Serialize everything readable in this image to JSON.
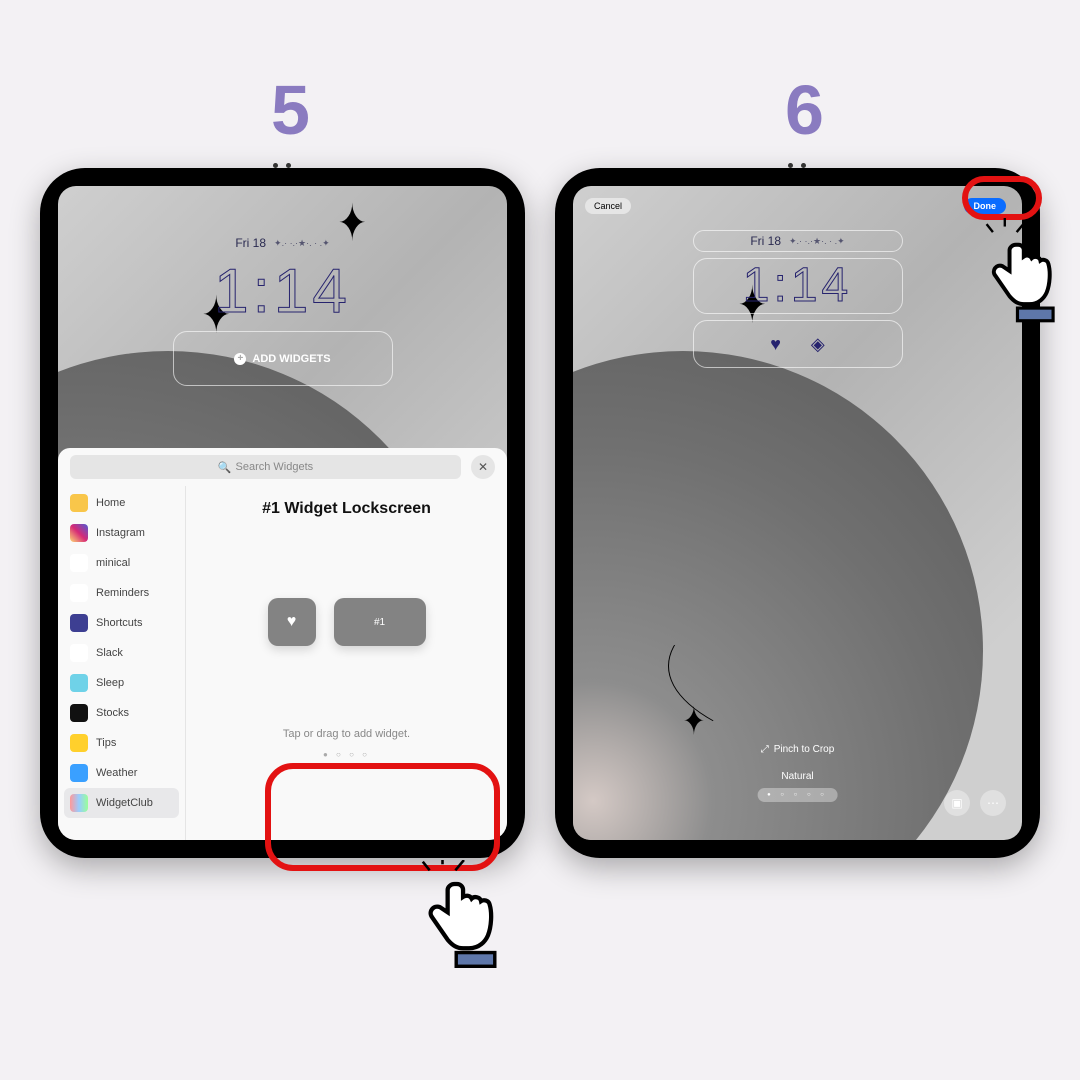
{
  "step_left_number": "5",
  "step_right_number": "6",
  "lock": {
    "date": "Fri 18",
    "date_deco": "✦.· ·.·★·. · .✦",
    "time": "1:14",
    "add_widgets_label": "ADD WIDGETS"
  },
  "sheet": {
    "search_placeholder": "Search Widgets",
    "apps": [
      {
        "name": "Home",
        "color": "#f9c64a"
      },
      {
        "name": "Instagram",
        "color": "linear-gradient(45deg,#feda75,#d62976,#4f5bd5)"
      },
      {
        "name": "minical",
        "color": "#fff"
      },
      {
        "name": "Reminders",
        "color": "#fff"
      },
      {
        "name": "Shortcuts",
        "color": "#3d3f92"
      },
      {
        "name": "Slack",
        "color": "#fff"
      },
      {
        "name": "Sleep",
        "color": "#6fd2e8"
      },
      {
        "name": "Stocks",
        "color": "#111"
      },
      {
        "name": "Tips",
        "color": "#ffd02c"
      },
      {
        "name": "Weather",
        "color": "#3aa0ff"
      },
      {
        "name": "WidgetClub",
        "color": "linear-gradient(90deg,#f99,#9cf,#9f9)"
      }
    ],
    "selected_index": 10,
    "picker_title": "#1 Widget Lockscreen",
    "preview_small_label": "♥",
    "preview_wide_label": "#1",
    "hint": "Tap or drag to add widget.",
    "pager": "● ○ ○ ○"
  },
  "edit": {
    "cancel_label": "Cancel",
    "done_label": "Done",
    "widget_icons": [
      "♥",
      "◈"
    ],
    "pinch_label": "Pinch to Crop",
    "filter_name": "Natural"
  }
}
